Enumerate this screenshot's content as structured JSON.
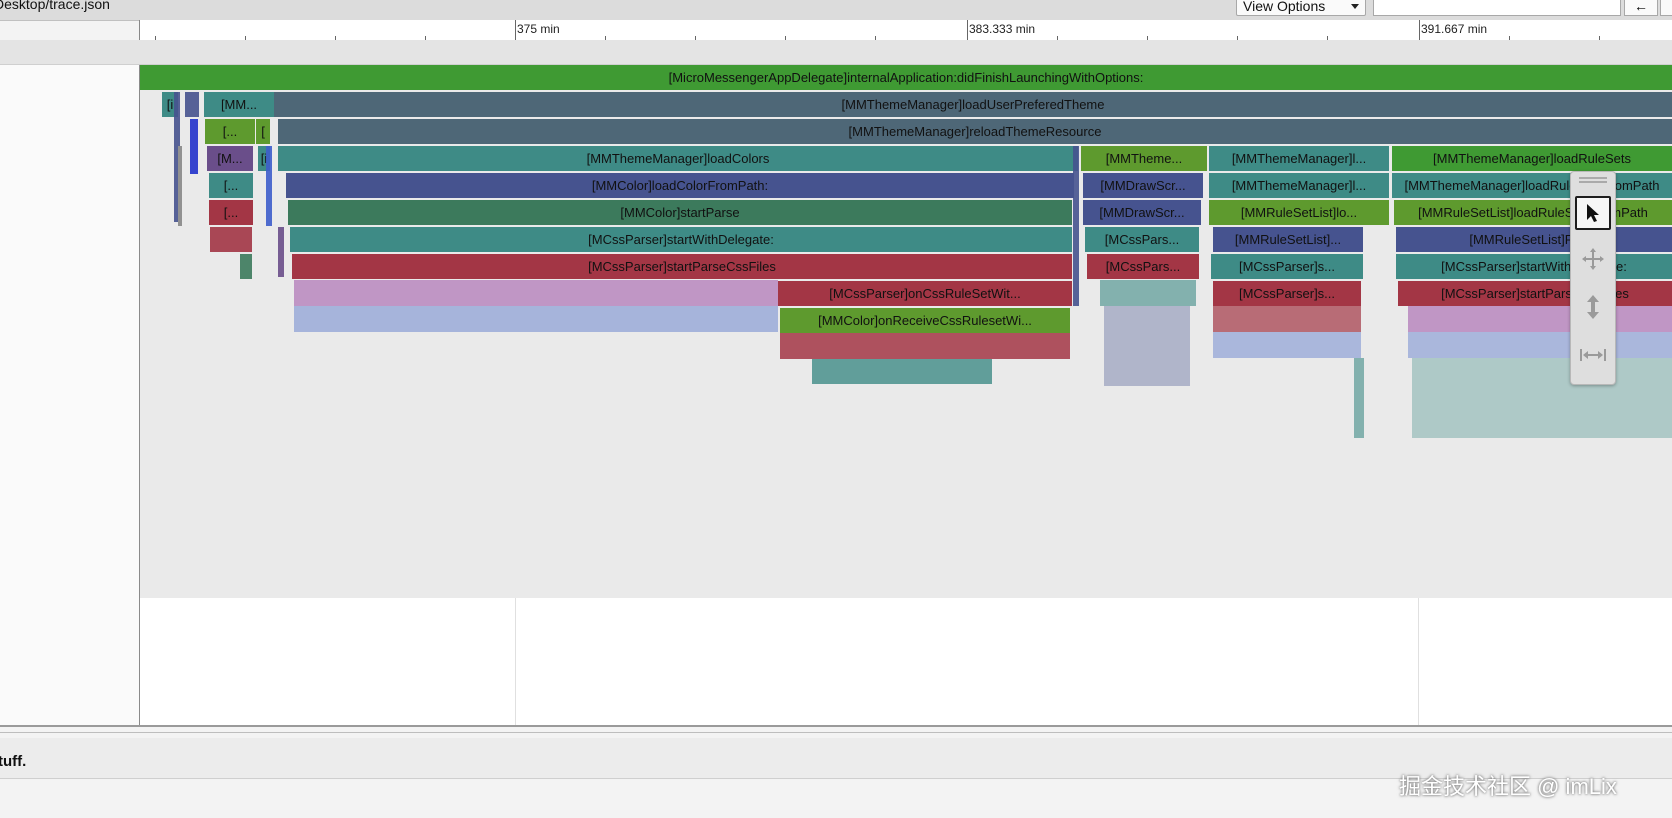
{
  "window": {
    "title": "Desktop/trace.json"
  },
  "toolbar": {
    "view_options_label": "View Options",
    "nav_left_label": "←"
  },
  "ruler": {
    "labels": [
      "375 min",
      "383.333 min",
      "391.667 min"
    ]
  },
  "slices": {
    "root": "[MicroMessengerAppDelegate]internalApplication:didFinishLaunchingWithOptions:",
    "r2_a": "[i",
    "r2_b": "[MM...",
    "r2_c": "[MMThemeManager]loadUserPreferedTheme",
    "r3_a": "[...",
    "r3_b": "[",
    "r3_c": "[MMThemeManager]reloadThemeResource",
    "r4_a": "[M...",
    "r4_b": "[i",
    "r4_c": "[MMThemeManager]loadColors",
    "r4_d": "[MMTheme...",
    "r4_e": "[MMThemeManager]l...",
    "r4_f": "[MMThemeManager]loadRuleSets",
    "r5_a": "[...",
    "r5_c": "[MMColor]loadColorFromPath:",
    "r5_d": "[MMDrawScr...",
    "r5_e": "[MMThemeManager]l...",
    "r5_f": "[MMThemeManager]loadRuleSetsFromPath",
    "r6_a": "[...",
    "r6_c": "[MMColor]startParse",
    "r6_d": "[MMDrawScr...",
    "r6_e": "[MMRuleSetList]lo...",
    "r6_f": "[MMRuleSetList]loadRuleSetsFromPath",
    "r7_c": "[MCssParser]startWithDelegate:",
    "r7_d": "[MCssPars...",
    "r7_e": "[MMRuleSetList]...",
    "r7_f": "[MMRuleSetList]Parse",
    "r8_c": "[MCssParser]startParseCssFiles",
    "r8_d": "[MCssPars...",
    "r8_e": "[MCssParser]s...",
    "r8_f": "[MCssParser]startWithDelegate:",
    "r9_c": "[MCssParser]onCssRuleSetWit...",
    "r9_e": "[MCssParser]s...",
    "r9_f": "[MCssParser]startParseCssFiles",
    "r10_c": "[MMColor]onReceiveCssRulesetWi..."
  },
  "footer": {
    "label": "tuff."
  },
  "watermark": {
    "text": "掘金技术社区 @ imLix"
  },
  "colors": {
    "green": "#3f9a33",
    "slate": "#4e6777",
    "teal": "#3e8b86",
    "navy": "#46538f",
    "forest": "#3c7a5c",
    "crimson": "#a33645",
    "lime": "#5e9a2e"
  },
  "icons": [
    "pointer-tool-icon",
    "pan-tool-icon",
    "zoom-tool-icon",
    "timing-tool-icon"
  ]
}
